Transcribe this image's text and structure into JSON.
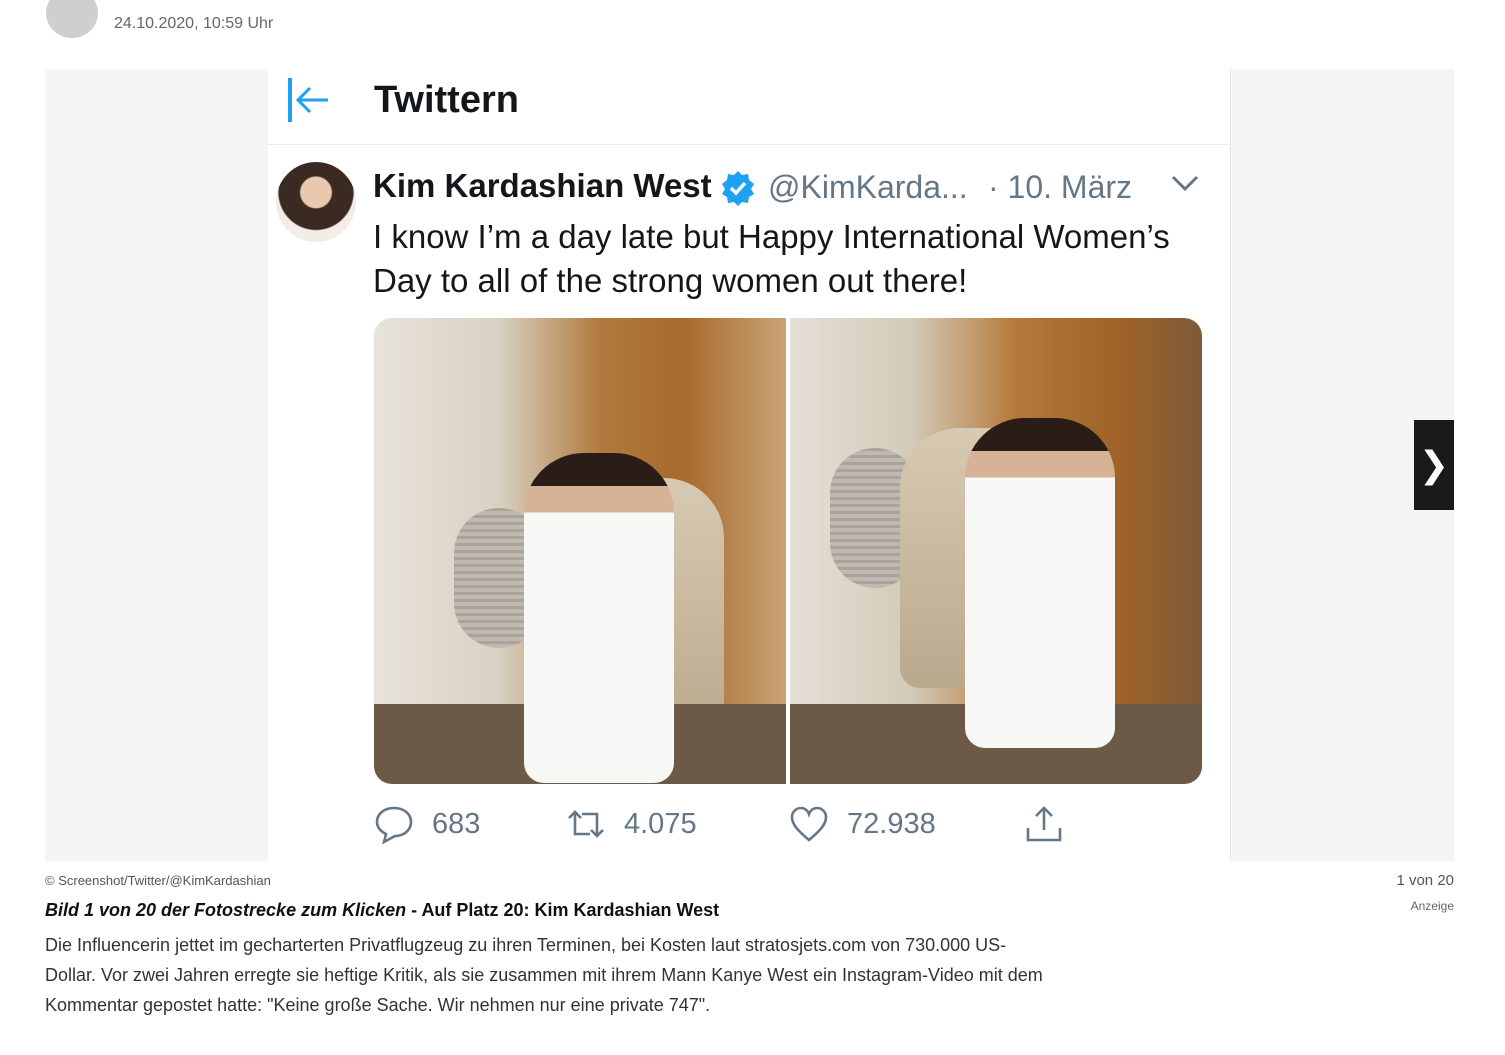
{
  "meta": {
    "timestamp": "24.10.2020, 10:59 Uhr"
  },
  "tweet": {
    "header_title": "Twittern",
    "author_name": "Kim Kardashian West",
    "handle": "@KimKarda...",
    "date": "· 10. März",
    "text": "I know I’m a day late but Happy International Women’s Day to all of the strong women out there!",
    "replies": "683",
    "retweets": "4.075",
    "likes": "72.938"
  },
  "gallery": {
    "credit": "© Screenshot/Twitter/@KimKardashian",
    "counter": "1 von 20",
    "ad_label": "Anzeige",
    "headline_italic": "Bild 1 von 20 der Fotostrecke zum Klicken",
    "headline_rest": " - Auf Platz 20: Kim Kardashian West",
    "description": "Die Influencerin jettet im gecharterten Privatflugzeug zu ihren Terminen, bei Kosten laut stratosjets.com von 730.000 US-Dollar. Vor zwei Jahren erregte sie heftige Kritik, als sie zusammen mit ihrem Mann Kanye West ein Instagram-Video mit dem Kommentar gepostet hatte: \"Keine große Sache. Wir nehmen nur eine private 747\".",
    "next_symbol": "❯"
  },
  "colors": {
    "twitter_blue": "#1da1f2",
    "twitter_gray": "#657786",
    "next_bg": "#1a1a1a"
  },
  "icons": [
    "back-arrow-icon",
    "verified-badge-icon",
    "chevron-down-icon",
    "reply-icon",
    "retweet-icon",
    "like-icon",
    "share-icon",
    "next-arrow-icon"
  ]
}
